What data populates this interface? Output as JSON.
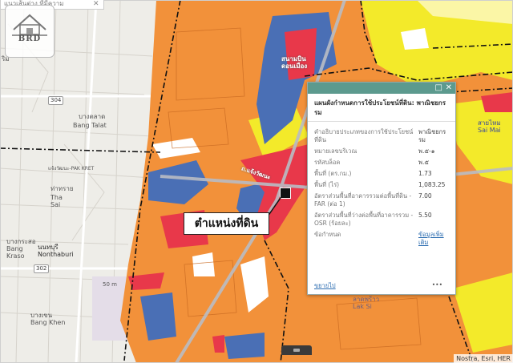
{
  "search": {
    "text": "แนวเส้นต่าง ที่มีความ"
  },
  "logo": {
    "text": "BRD"
  },
  "map": {
    "labels": [
      {
        "key": "don_mueang",
        "text": "สนามบิน\nดอนเมือง"
      },
      {
        "key": "bang_talat_th",
        "text": "บางตลาด"
      },
      {
        "key": "bang_talat_en",
        "text": "Bang Talat"
      },
      {
        "key": "tha_sai_th",
        "text": "ท่าทราย"
      },
      {
        "key": "tha_sai_en",
        "text": "Tha\nSai"
      },
      {
        "key": "bang_krasor",
        "text": "บางกระสอ\nBang\nKraso"
      },
      {
        "key": "nonthaburi",
        "text": "นนทบุรี\nNonthaburi"
      },
      {
        "key": "bang_khen",
        "text": "บางเขน\nBang Khen"
      },
      {
        "key": "lak_si",
        "text": "ลาดพร้าว\nLak Si"
      },
      {
        "key": "sai_mai",
        "text": "สายไหม\nSai Mai"
      },
      {
        "key": "vibhavadi",
        "text": "ถ.แจ้งวัฒนะ"
      },
      {
        "key": "pak_kret",
        "text": "แจ้งวัฒนะ-PAK KRET"
      },
      {
        "key": "edge_ri",
        "text": "ริม"
      },
      {
        "key": "scale",
        "text": "50 m"
      }
    ],
    "road_shields": [
      "304",
      "302"
    ]
  },
  "popup": {
    "title": "แผนผังกำหนดการใช้ประโยชน์ที่ดิน: พาณิชยกรรม",
    "rows": [
      {
        "label": "คำอธิบายประเภทของการใช้ประโยชน์ที่ดิน",
        "value": "พาณิชยกรรม"
      },
      {
        "label": "หมายเลขบริเวณ",
        "value": "พ.๕-๑"
      },
      {
        "label": "รหัสบล็อค",
        "value": "พ.๕"
      },
      {
        "label": "พื้นที่ (ตร.กม.)",
        "value": "1.73"
      },
      {
        "label": "พื้นที่ (ไร่)",
        "value": "1,083.25"
      },
      {
        "label": "อัตราส่วนพื้นที่อาคารรวมต่อพื้นที่ดิน - FAR (ต่อ 1)",
        "value": "7.00"
      },
      {
        "label": "อัตราส่วนพื้นที่ว่างต่อพื้นที่อาคารรวม - OSR (ร้อยละ)",
        "value": "5.50"
      },
      {
        "label": "ข้อกำหนด",
        "value": "ข้อมูลเพิ่มเติม"
      }
    ],
    "zoom_label": "ขยายไป",
    "more_label": "•••",
    "minimize_icon": "□",
    "close_icon": "✕"
  },
  "callout": {
    "text": "ตำแหน่งที่ดิน"
  },
  "attribution": {
    "text": "Nostra, Esri, HER"
  },
  "colors": {
    "commercial_red": "#e8384a",
    "residential_orange": "#f2913a",
    "government_blue": "#4a6fb5",
    "yellow_zone": "#f3ea2a",
    "popup_header": "#5c9a8e"
  }
}
